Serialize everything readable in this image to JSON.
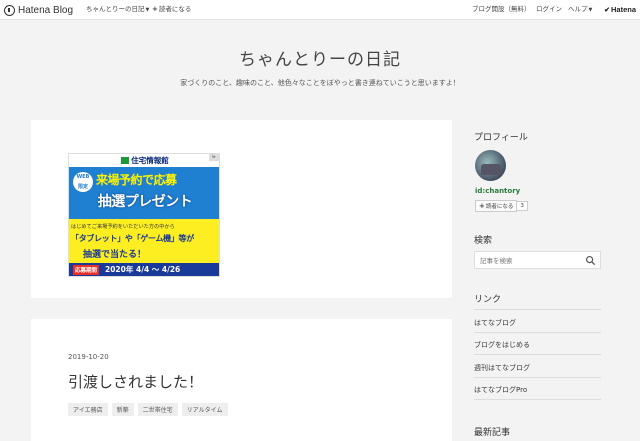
{
  "header": {
    "logo_text": "Hatena Blog",
    "blog_menu": "ちゃんとりーの日記",
    "subscribe": "読者になる",
    "start_blog": "ブログ開設（無料）",
    "login": "ログイン",
    "help": "ヘルプ",
    "hatena": "Hatena"
  },
  "blog": {
    "title": "ちゃんとりーの日記",
    "description": "家づくりのこと、趣味のこと、他色々なことをぼやっと書き連ねていこうと思いますよ！"
  },
  "ad": {
    "brand": "住宅情報館",
    "web_badge_1": "WEB",
    "web_badge_2": "限定",
    "line1": "来場予約で応募",
    "line2": "抽選プレゼント",
    "line3": "はじめてご来場予約をいただいた方の中から",
    "line4": "「タブレット」や「ゲーム機」等が",
    "line5": "抽選で当たる！",
    "period_badge": "応募期間",
    "period": "2020年 4/4 ～ 4/26"
  },
  "entry": {
    "date": "2019-10-20",
    "title": "引渡しされました！",
    "categories": [
      "アイエ務店",
      "新築",
      "二世帯住宅",
      "リアルタイム"
    ]
  },
  "sidebar": {
    "profile_heading": "プロフィール",
    "user_id": "id:chantory",
    "subscribe_label": "読者になる",
    "subscriber_count": "3",
    "search_heading": "検索",
    "search_placeholder": "記事を検索",
    "links_heading": "リンク",
    "links": [
      "はてなブログ",
      "ブログをはじめる",
      "週刊はてなブログ",
      "はてなブログPro"
    ],
    "recent_heading": "最新記事"
  }
}
